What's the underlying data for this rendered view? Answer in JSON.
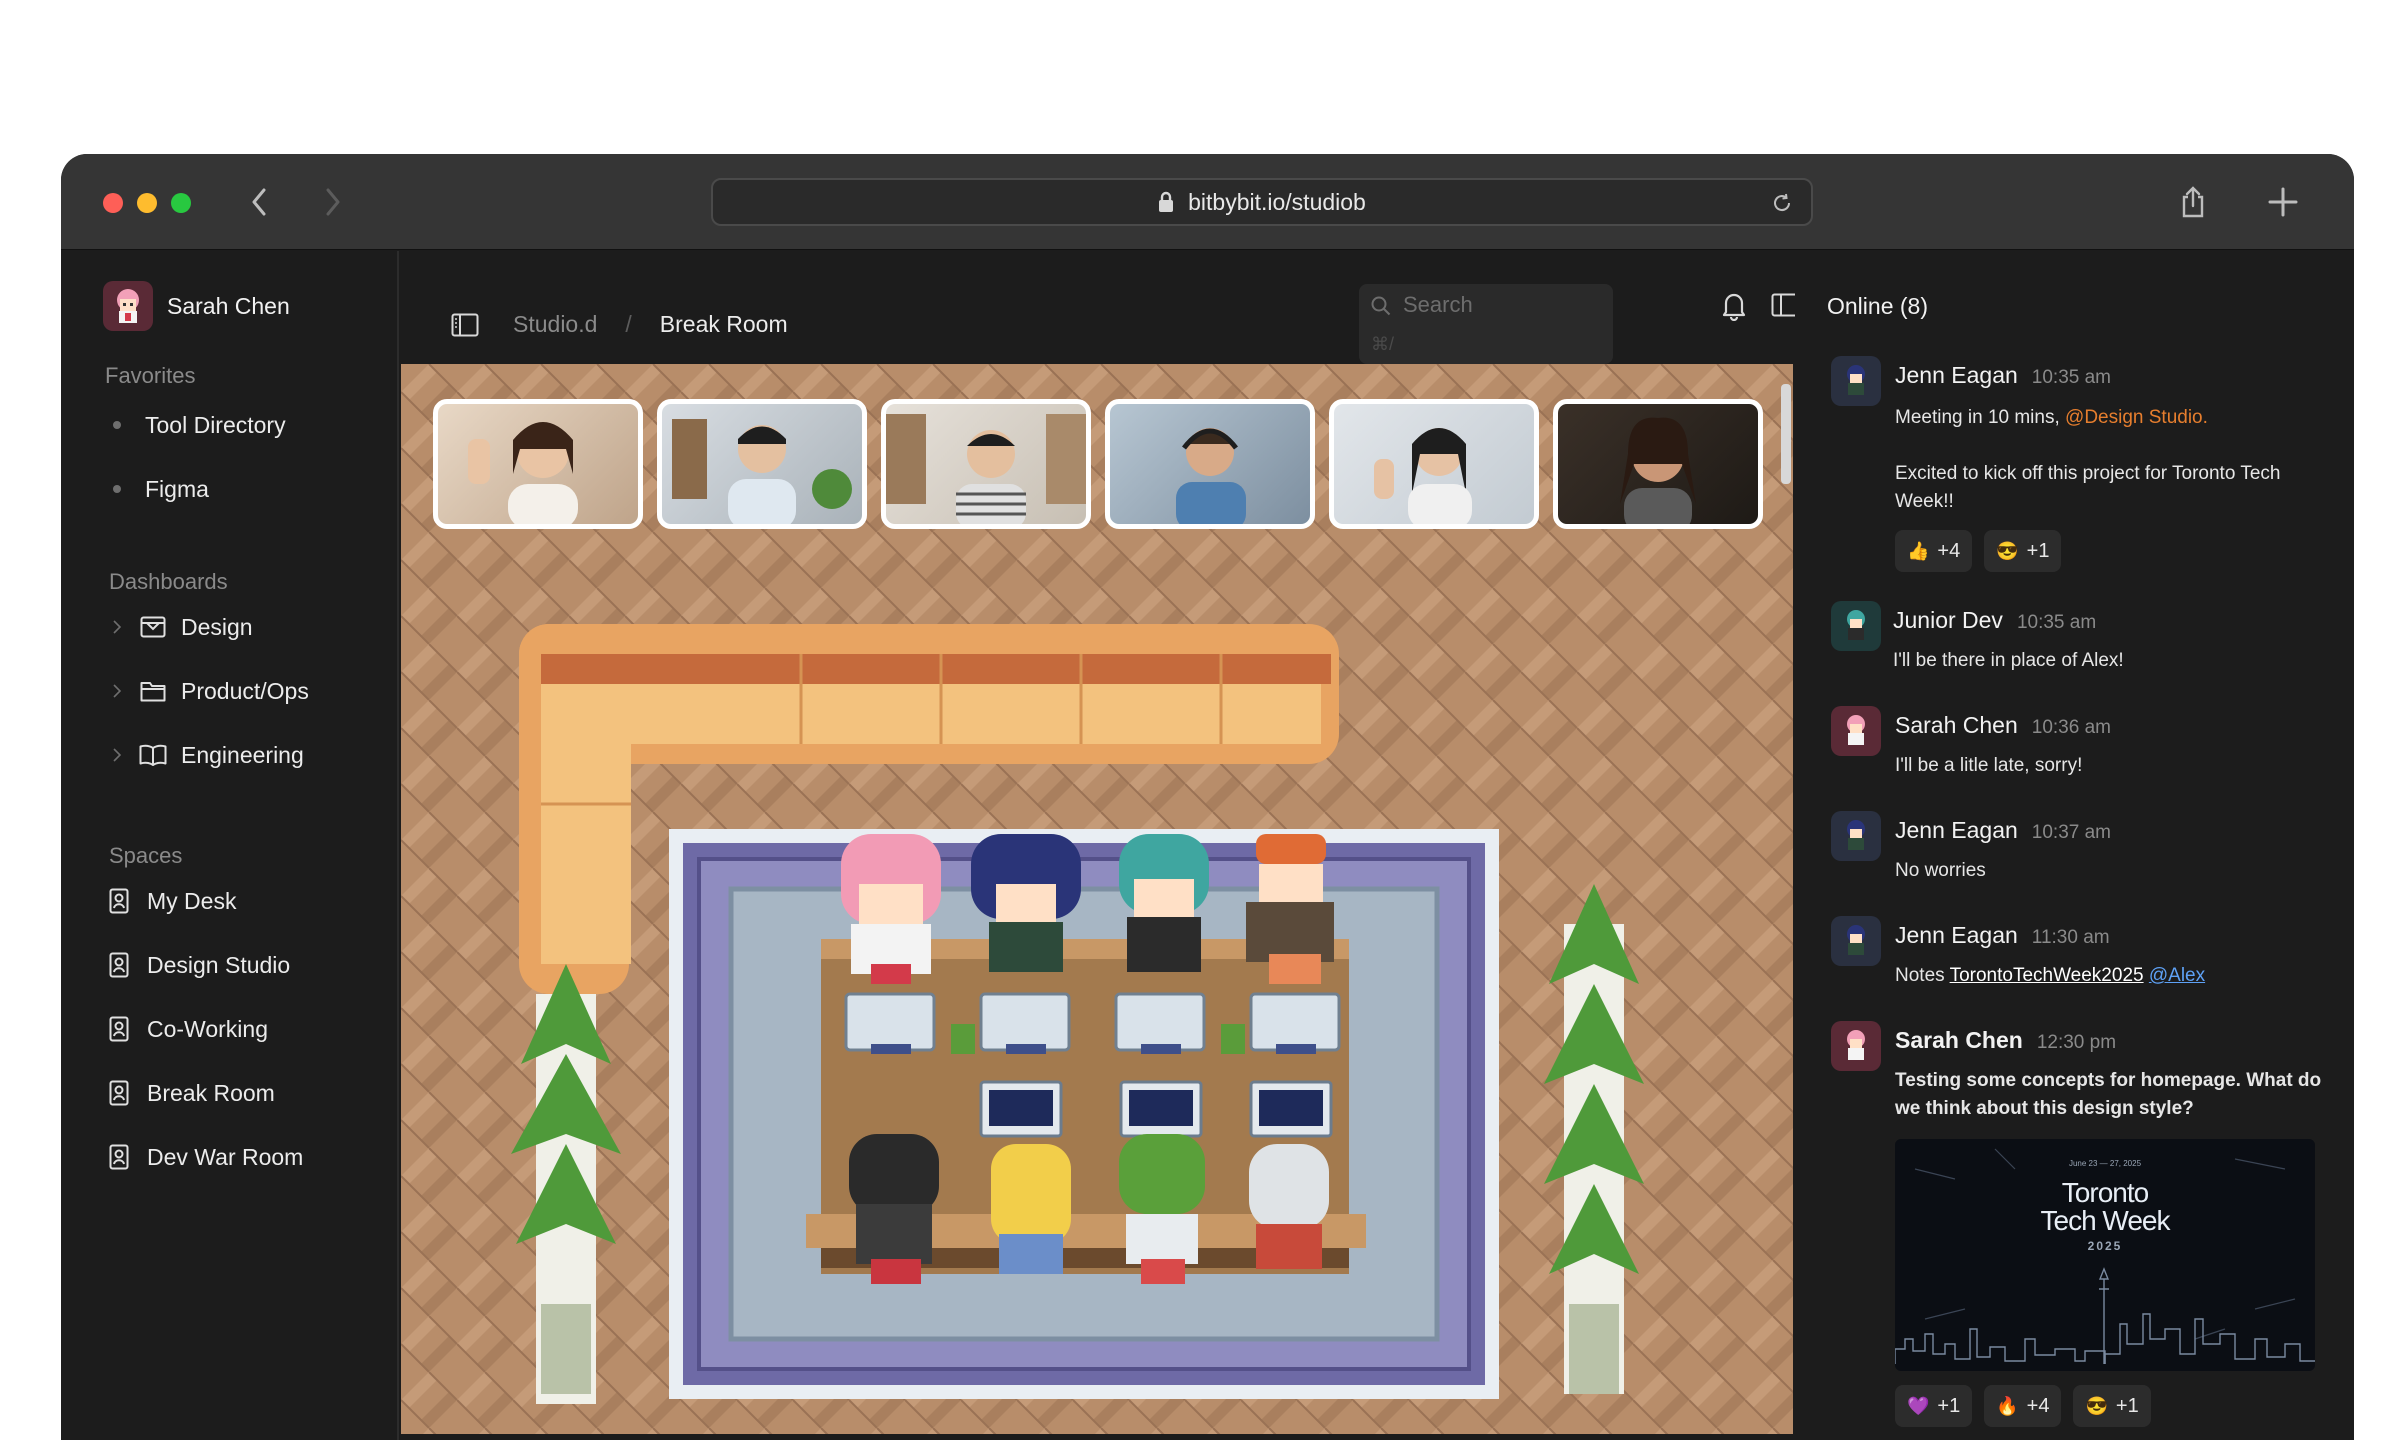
{
  "browser": {
    "url": "bitbybit.io/studiob"
  },
  "sidebar": {
    "user_name": "Sarah Chen",
    "favorites_heading": "Favorites",
    "favorites": [
      {
        "label": "Tool Directory"
      },
      {
        "label": "Figma"
      }
    ],
    "dashboards_heading": "Dashboards",
    "dashboards": [
      {
        "label": "Design",
        "icon": "inbox-icon"
      },
      {
        "label": "Product/Ops",
        "icon": "folder-icon"
      },
      {
        "label": "Engineering",
        "icon": "book-icon"
      }
    ],
    "spaces_heading": "Spaces",
    "spaces": [
      {
        "label": "My Desk"
      },
      {
        "label": "Design Studio"
      },
      {
        "label": "Co-Working"
      },
      {
        "label": "Break Room"
      },
      {
        "label": "Dev War Room"
      }
    ]
  },
  "main": {
    "breadcrumb_parent": "Studio.d",
    "breadcrumb_sep": "/",
    "breadcrumb_current": "Break Room",
    "search_placeholder": "Search",
    "search_shortcut": "⌘/"
  },
  "chat": {
    "online_label": "Online (8)",
    "messages": [
      {
        "name": "Jenn Eagan",
        "time": "10:35 am",
        "text_a": "Meeting in 10 mins, ",
        "mention": "@Design Studio.",
        "text_b": "Excited to kick off this project for Toronto Tech Week!!",
        "reactions": [
          {
            "emoji": "👍",
            "count": "+4"
          },
          {
            "emoji": "😎",
            "count": "+1"
          }
        ]
      },
      {
        "name": "Junior Dev",
        "time": "10:35 am",
        "text": "I'll be there in place of Alex!"
      },
      {
        "name": "Sarah Chen",
        "time": "10:36 am",
        "text": "I'll be a litle late, sorry!"
      },
      {
        "name": "Jenn Eagan",
        "time": "10:37 am",
        "text": "No worries"
      },
      {
        "name": "Jenn Eagan",
        "time": "11:30 am",
        "text": "Notes ",
        "link": "TorontoTechWeek2025",
        "mention": "@Alex"
      },
      {
        "name": "Sarah Chen",
        "time": "12:30 pm",
        "text": "Testing some concepts for homepage. What do we think about this design style?",
        "reactions": [
          {
            "emoji": "💜",
            "count": "+1"
          },
          {
            "emoji": "🔥",
            "count": "+4"
          },
          {
            "emoji": "😎",
            "count": "+1"
          }
        ]
      }
    ],
    "card": {
      "date": "June 23 — 27, 2025",
      "title_line1": "Toronto",
      "title_line2": "Tech Week",
      "year": "2025"
    }
  },
  "colors": {
    "window_bg": "#1c1c1c",
    "titlebar": "#353535",
    "mention": "#e67e2e",
    "link_blue": "#5ea1f5",
    "floor": "#b38a68",
    "traffic_red": "#fe5f57",
    "traffic_yellow": "#febc2e",
    "traffic_green": "#28c840"
  }
}
